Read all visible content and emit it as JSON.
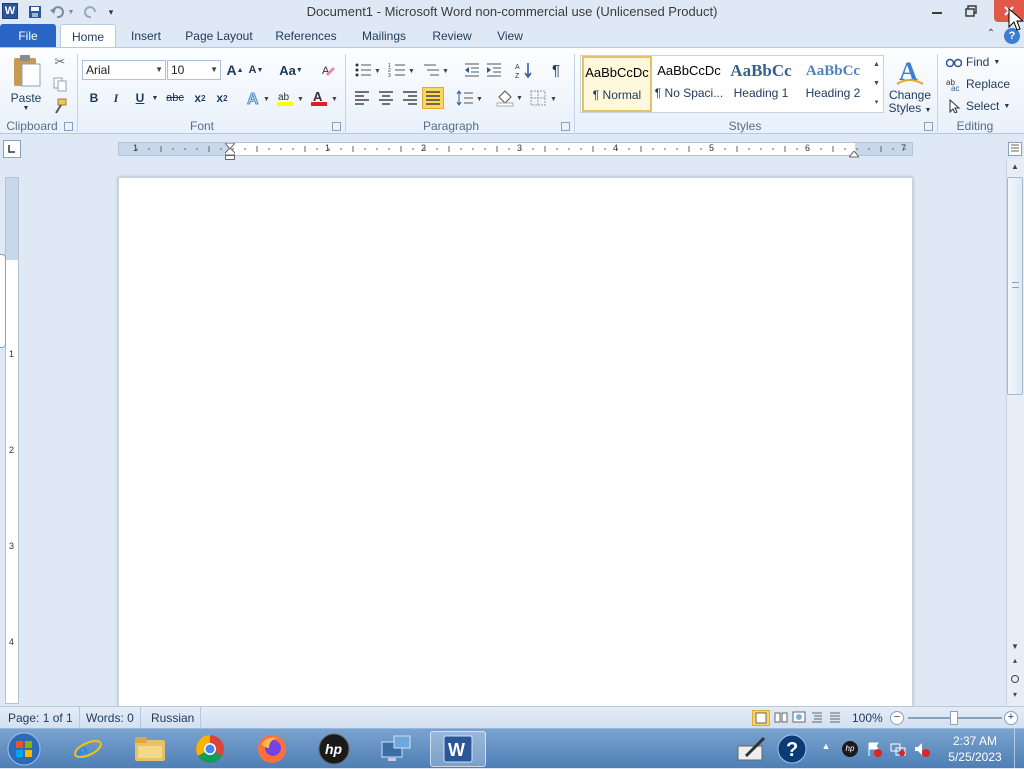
{
  "titlebar": {
    "title": "Document1  -  Microsoft Word non-commercial use (Unlicensed Product)",
    "app_icon": "W"
  },
  "tabs": [
    "File",
    "Home",
    "Insert",
    "Page Layout",
    "References",
    "Mailings",
    "Review",
    "View"
  ],
  "active_tab": "Home",
  "clipboard": {
    "paste_label": "Paste",
    "group_label": "Clipboard"
  },
  "font": {
    "name": "Arial",
    "size": "10",
    "group_label": "Font",
    "case_label": "Aa",
    "grow_label": "A",
    "shrink_label": "A",
    "color_letter": "A",
    "font_color": "#e02020",
    "highlight_color": "#ffff00"
  },
  "paragraph": {
    "group_label": "Paragraph"
  },
  "styles": {
    "group_label": "Styles",
    "items": [
      {
        "sample": "AaBbCcDc",
        "name": "¶ Normal"
      },
      {
        "sample": "AaBbCcDc",
        "name": "¶ No Spaci..."
      },
      {
        "sample": "AaBbCc",
        "name": "Heading 1"
      },
      {
        "sample": "AaBbCc",
        "name": "Heading 2"
      }
    ],
    "change_styles_line1": "Change",
    "change_styles_line2": "Styles"
  },
  "editing": {
    "group_label": "Editing",
    "find": "Find",
    "replace": "Replace",
    "select": "Select"
  },
  "ruler": {
    "numbers": [
      "1",
      "1",
      "2",
      "3",
      "4",
      "5",
      "6",
      "7"
    ],
    "vnumbers": [
      "1",
      "2",
      "3",
      "4"
    ]
  },
  "status": {
    "page": "Page: 1 of 1",
    "words": "Words: 0",
    "language": "Russian",
    "zoom": "100%"
  },
  "taskbar": {
    "time": "2:37 AM",
    "date": "5/25/2023"
  },
  "colors": {
    "file_tab": "#2a64c5",
    "close_button": "#e05a4a",
    "taskbar": "#5b89be",
    "selected_style_border": "#e5c365"
  }
}
